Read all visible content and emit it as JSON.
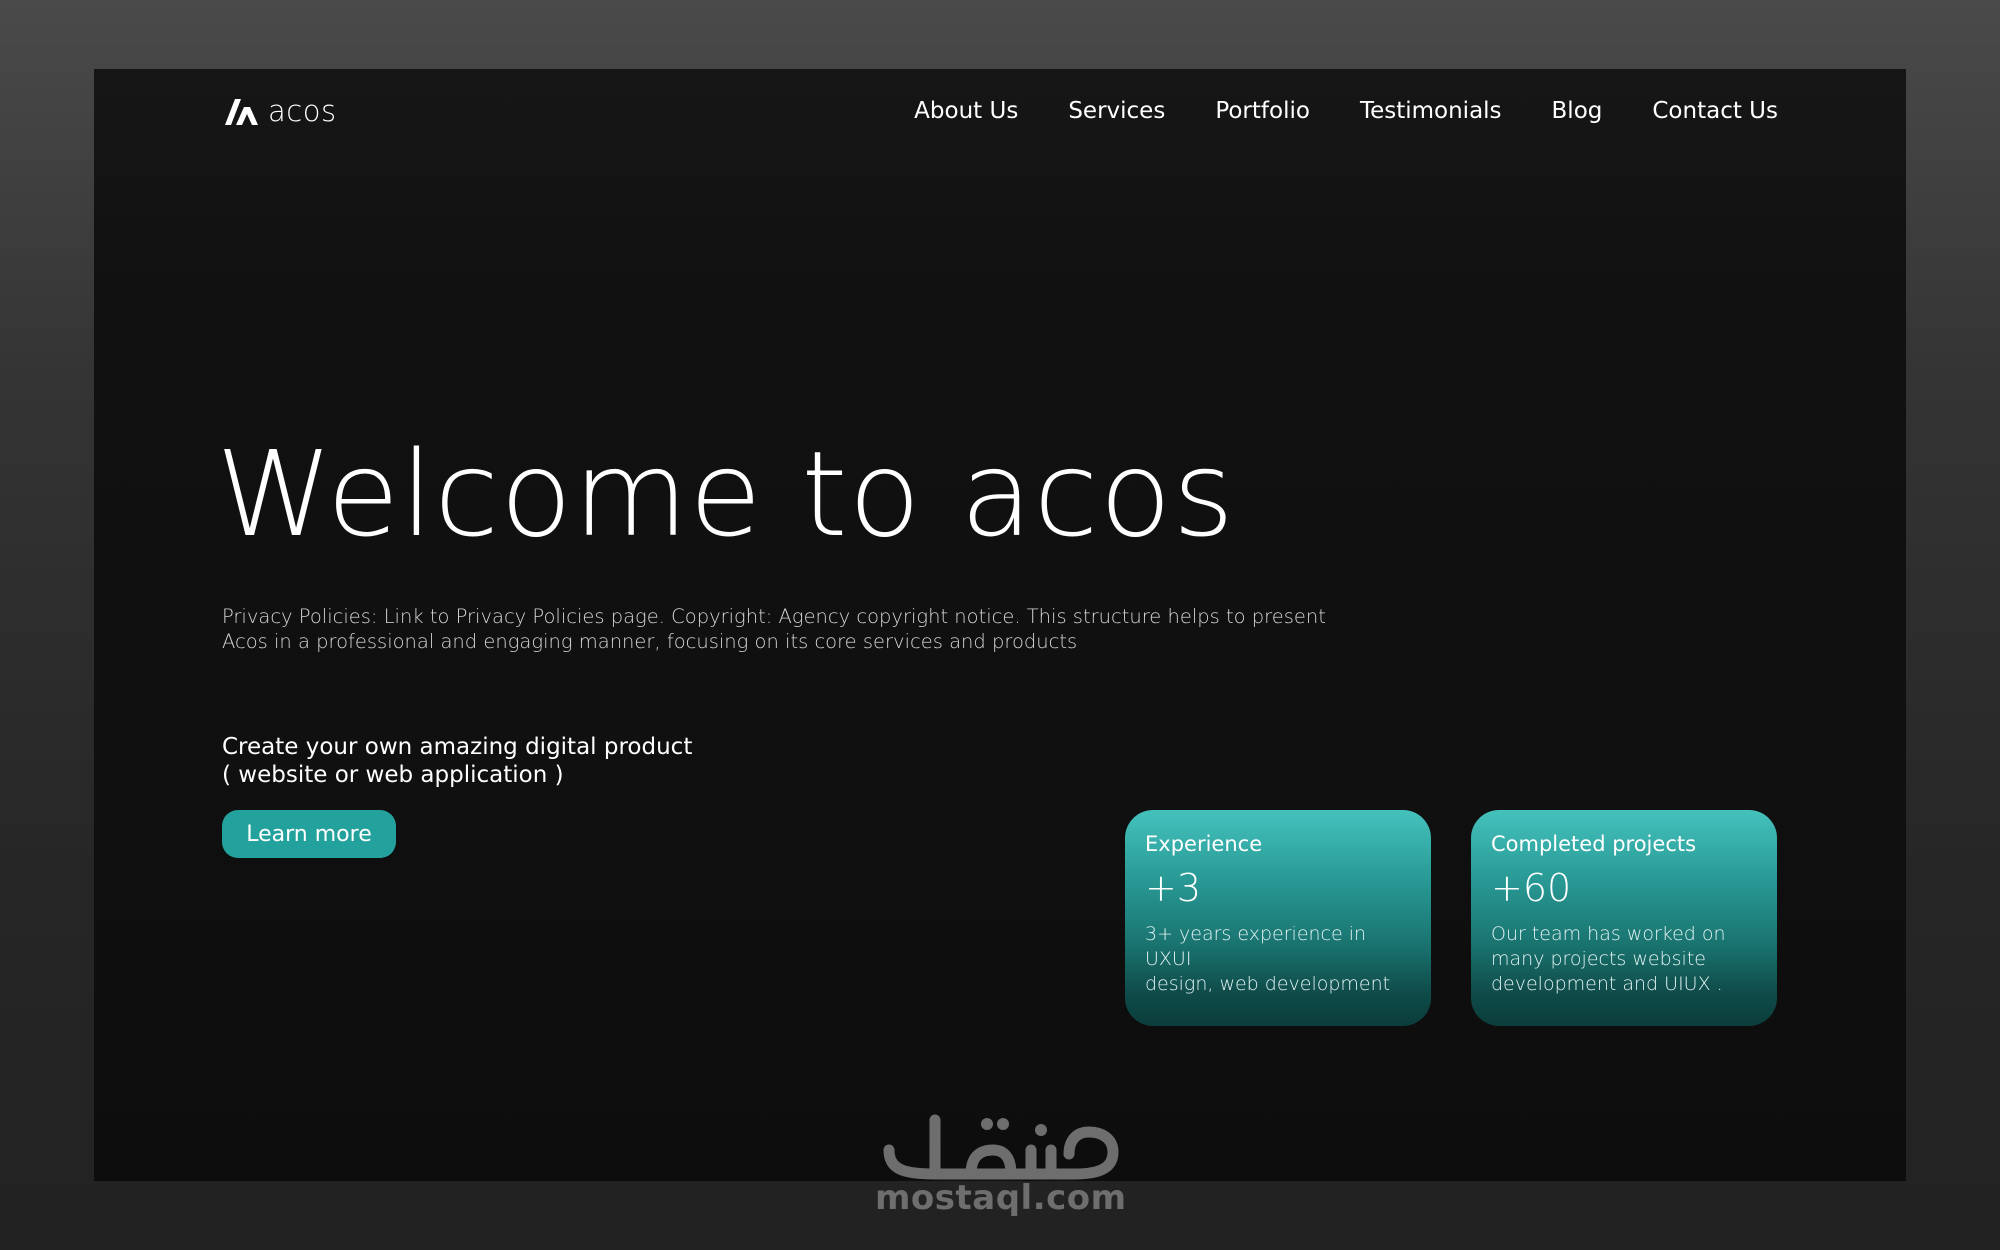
{
  "brand": {
    "name": "acos",
    "icon": "acos-logo-mark"
  },
  "nav": {
    "items": [
      {
        "label": "About Us"
      },
      {
        "label": "Services"
      },
      {
        "label": "Portfolio"
      },
      {
        "label": "Testimonials"
      },
      {
        "label": "Blog"
      },
      {
        "label": "Contact Us"
      }
    ]
  },
  "hero": {
    "title": "Welcome to acos",
    "description": "Privacy Policies: Link to Privacy Policies page. Copyright: Agency copyright notice. This structure helps to present Acos in a professional and engaging manner, focusing on its core services and products",
    "cta_line1": "Create your own amazing digital product",
    "cta_line2": "( website or web application )",
    "button_label": "Learn more"
  },
  "stats": [
    {
      "label": "Experience",
      "value": "+3",
      "description": "3+ years experience in UXUI\ndesign, web development"
    },
    {
      "label": "Completed projects",
      "value": "+60",
      "description": "Our team has worked on\nmany projects website\n development and UIUX ."
    }
  ],
  "watermark": {
    "logo_text": "مستقل",
    "domain": "mostaql.com"
  },
  "colors": {
    "accent": "#23a19c",
    "card_top": "#45c2bd",
    "card_bottom": "#0b3d3b",
    "background": "#101010"
  }
}
